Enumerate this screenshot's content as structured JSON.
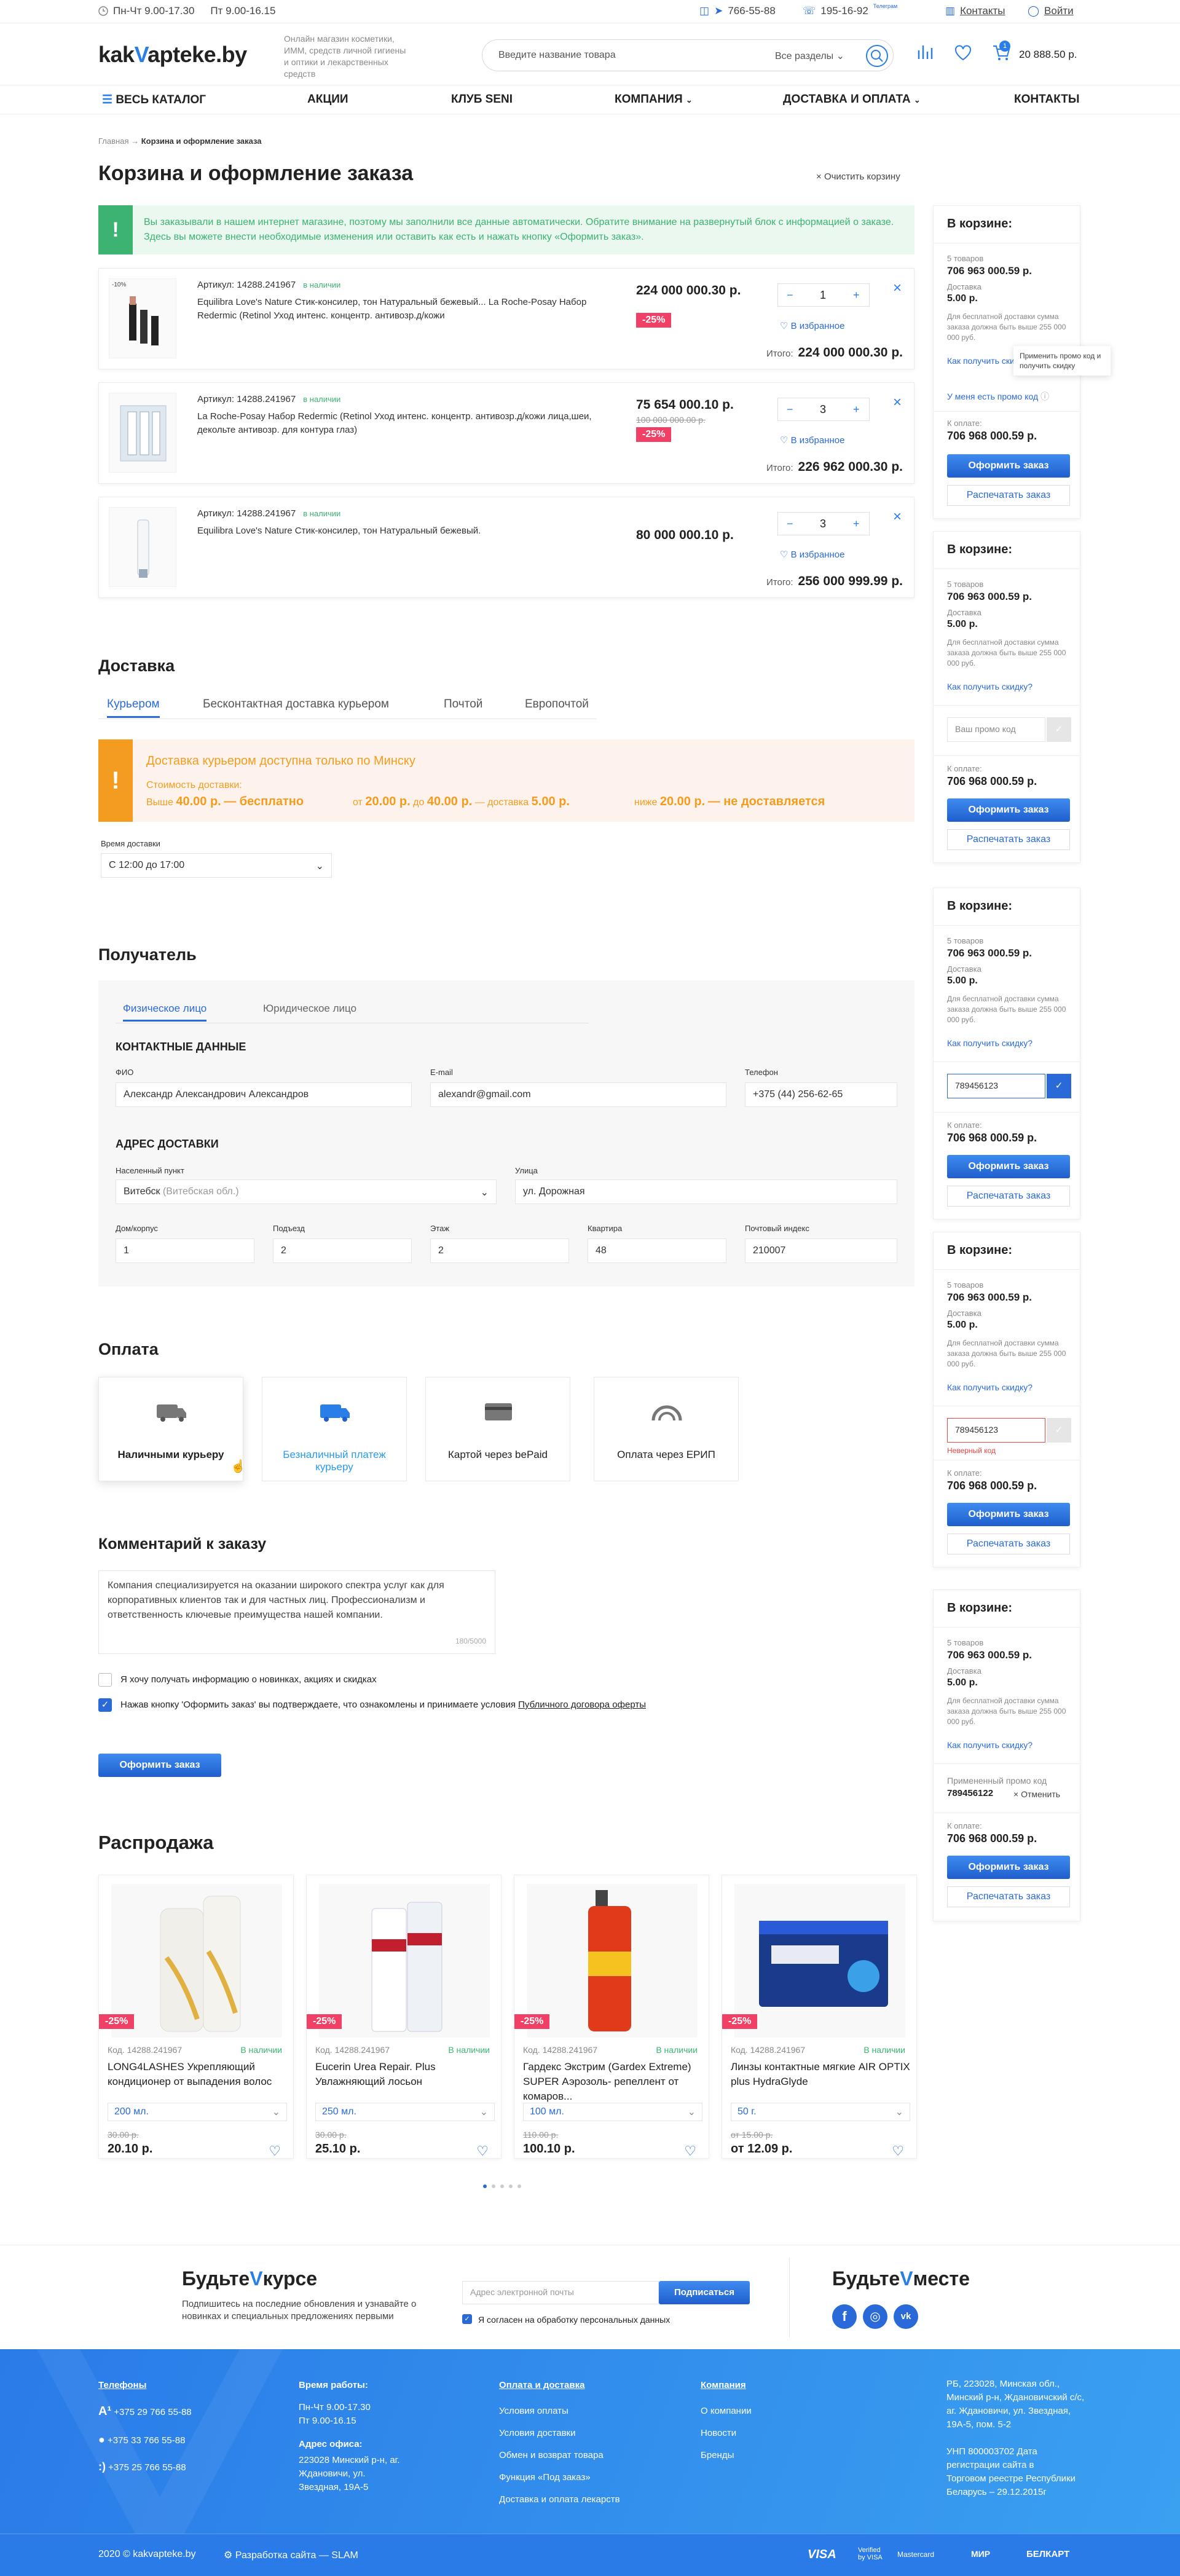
{
  "topbar": {
    "hours1": "Пн-Чт 9.00-17.30",
    "hours2": "Пт 9.00-16.15",
    "phone1": "766-55-88",
    "phone2": "195-16-92",
    "phone2_note": "Телеграм",
    "contacts": "Контакты",
    "login": "Войти"
  },
  "header": {
    "logo_a": "kak",
    "logo_v": "V",
    "logo_b": "apteke.by",
    "tagline": "Онлайн магазин косметики, ИММ, средств личной гигиены и оптики и лекарственных средств",
    "search_placeholder": "Введите название товара",
    "search_section": "Все разделы",
    "cart_count": "1",
    "cart_total": "20 888.50 р."
  },
  "nav": [
    "ВЕСЬ КАТАЛОГ",
    "АКЦИИ",
    "КЛУБ SENI",
    "КОМПАНИЯ",
    "ДОСТАВКА И ОПЛАТА",
    "КОНТАКТЫ"
  ],
  "breadcrumb": {
    "home": "Главная",
    "current": "Корзина и оформление заказа"
  },
  "page_title": "Корзина и оформление заказа",
  "clear_cart": "Очистить корзину",
  "notice": "Вы заказывали в нашем интернет магазине, поэтому мы заполнили все данные автоматически. Обратите внимание на развернутый блок с информацией о заказе. Здесь вы можете внести необходимые изменения или оставить как есть и нажать кнопку «Оформить заказ».",
  "products": [
    {
      "article": "Артикул: 14288.241967",
      "stock": "в наличии",
      "name": "Equilibra Love's Nature Стик-консилер, тон Натуральный бежевый... La Roche-Posay Набор Redermic (Retinol Уход интенс. концентр. антивозр.д/кожи",
      "price": "224 000 000.30 р.",
      "old": "",
      "discount": "-25%",
      "qty": "1",
      "fav": "В избранное",
      "total_label": "Итого:",
      "total": "224 000 000.30 р.",
      "img_badge": "-10%"
    },
    {
      "article": "Артикул: 14288.241967",
      "stock": "в наличии",
      "name": "La Roche-Posay Набор Redermic (Retinol Уход интенс. концентр. антивозр.д/кожи лица,шеи, декольте антивозр. для контура глаз)",
      "price": "75 654 000.10 р.",
      "old": "100 000 000.00 р.",
      "discount": "-25%",
      "qty": "3",
      "fav": "В избранное",
      "total_label": "Итого:",
      "total": "226 962 000.30 р."
    },
    {
      "article": "Артикул: 14288.241967",
      "stock": "в наличии",
      "name": "Equilibra Love's Nature Стик-консилер, тон Натуральный бежевый.",
      "price": "80 000 000.10 р.",
      "old": "",
      "discount": "",
      "qty": "3",
      "fav": "В избранное",
      "total_label": "Итого:",
      "total": "256 000 999.99 р."
    }
  ],
  "delivery": {
    "title": "Доставка",
    "tabs": [
      "Курьером",
      "Бесконтактная доставка курьером",
      "Почтой",
      "Европочтой"
    ],
    "warn_title": "Доставка курьером доступна только по Минску",
    "cost_label": "Стоимость доставки:",
    "c1a": "Выше",
    "c1b": "40.00 р.",
    "c1c": "— бесплатно",
    "c2a": "от",
    "c2b": "20.00 р.",
    "c2c": "до",
    "c2d": "40.00 р.",
    "c2e": "— доставка",
    "c2f": "5.00 р.",
    "c3a": "ниже",
    "c3b": "20.00 р.",
    "c3c": "— не доставляется",
    "time_label": "Время доставки",
    "time_value": "С 12:00 до 17:00"
  },
  "recipient": {
    "title": "Получатель",
    "tabs": [
      "Физическое лицо",
      "Юридическое лицо"
    ],
    "contacts_h": "КОНТАКТНЫЕ ДАННЫЕ",
    "fio_l": "ФИО",
    "fio": "Александр Александрович Александров",
    "email_l": "E-mail",
    "email": "alexandr@gmail.com",
    "phone_l": "Телефон",
    "phone": "+375 (44) 256-62-65",
    "addr_h": "АДРЕС ДОСТАВКИ",
    "city_l": "Населенный пункт",
    "city": "Витебск",
    "city_region": "(Витебская обл.)",
    "street_l": "Улица",
    "street": "ул. Дорожная",
    "house_l": "Дом/корпус",
    "house": "1",
    "porch_l": "Подъезд",
    "porch": "2",
    "floor_l": "Этаж",
    "floor": "2",
    "flat_l": "Квартира",
    "flat": "48",
    "zip_l": "Почтовый индекс",
    "zip": "210007"
  },
  "payment": {
    "title": "Оплата",
    "options": [
      "Наличными курьеру",
      "Безналичный платеж курьеру",
      "Картой через bePaid",
      "Оплата через ЕРИП"
    ]
  },
  "comment": {
    "title": "Комментарий к заказу",
    "text": "Компания специализируется на оказании широкого спектра услуг как для корпоративных клиентов так и для частных лиц. Профессионализм и ответственность ключевые преимущества нашей компании.",
    "counter": "180/5000"
  },
  "agree": {
    "news": "Я хочу получать информацию о новинках, акциях и скидках",
    "offer_a": "Нажав кнопку 'Оформить заказ' вы подтверждаете, что ознакомлены и принимаете условия",
    "offer_link": "Публичного договора оферты"
  },
  "submit": "Оформить заказ",
  "side": {
    "title": "В корзине:",
    "items": "5 товаров",
    "items_sum": "706 963 000.59 р.",
    "delivery_l": "Доставка",
    "delivery_v": "5.00 р.",
    "note": "Для бесплатной доставки сумма заказа должна быть выше 255 000 000 руб.",
    "discount_link": "Как получить скидку?",
    "tooltip": "Применить промо код и получить скидку",
    "promo_link": "У меня есть промо код",
    "promo_ph": "Ваш промо код",
    "promo_val": "789456123",
    "promo_err": "Неверный код",
    "applied_l": "Примененный промо код",
    "applied_v": "789456122",
    "cancel": "Отменить",
    "pay_l": "К оплате:",
    "pay_v": "706 968 000.59 р.",
    "btn": "Оформить заказ",
    "print": "Распечатать заказ"
  },
  "sale": {
    "title": "Распродажа",
    "items": [
      {
        "code": "Код. 14288.241967",
        "stock": "В наличии",
        "name": "LONG4LASHES Укрепляющий кондиционер от выпадения волос",
        "opt": "200 мл.",
        "old": "30.00 р.",
        "price": "20.10 р.",
        "badge": "-25%"
      },
      {
        "code": "Код. 14288.241967",
        "stock": "В наличии",
        "name": "Eucerin Urea Repair. Plus Увлажняющий лосьон",
        "opt": "250 мл.",
        "old": "30.00 р.",
        "price": "25.10 р.",
        "badge": "-25%"
      },
      {
        "code": "Код. 14288.241967",
        "stock": "В наличии",
        "name": "Гардекс Экстрим (Gardex Extreme) SUPER Аэрозоль- репеллент от комаров...",
        "opt": "100 мл.",
        "old": "110.00 р.",
        "price": "100.10 р.",
        "badge": "-25%"
      },
      {
        "code": "Код. 14288.241967",
        "stock": "В наличии",
        "name": "Линзы контактные мягкие AIR OPTIX plus HydraGlyde",
        "opt": "50 г.",
        "old": "от 15.00 р.",
        "price": "от 12.09 р.",
        "badge": "-25%"
      }
    ]
  },
  "subscribe": {
    "title_a": "Будьте",
    "title_v": "V",
    "title_b": "курсе",
    "text": "Подпишитесь на последние обновления и узнавайте о новинках и специальных предложениях первыми",
    "ph": "Адрес электронной почты",
    "btn": "Подписаться",
    "consent": "Я согласен на обработку персональных данных",
    "together_a": "Будьте",
    "together_b": "месте"
  },
  "footer": {
    "phones_h": "Телефоны",
    "phones": [
      "+375 29 766 55-88",
      "+375 33 766 55-88",
      "+375 25 766 55-88"
    ],
    "hours_h": "Время работы:",
    "hours": [
      "Пн-Чт 9.00-17.30",
      "Пт 9.00-16.15"
    ],
    "office_h": "Адрес офиса:",
    "office": "223028 Минский р-н, аг. Ждановичи, ул. Звездная, 19А-5",
    "pay_h": "Оплата и доставка",
    "pay_links": [
      "Условия оплаты",
      "Условия доставки",
      "Обмен и возврат товара",
      "Функция «Под заказ»",
      "Доставка и оплата лекарств"
    ],
    "company_h": "Компания",
    "company_links": [
      "О компании",
      "Новости",
      "Бренды"
    ],
    "legal": "РБ, 223028, Минская обл., Минский р-н, Ждановичский с/с, аг. Ждановичи, ул. Звездная, 19А-5, пом. 5-2",
    "unp": "УНП 800003702 Дата регистрации сайта в Торговом реестре Республики Беларусь – 29.12.2015г",
    "copy": "2020 © kakvapteke.by",
    "dev": "Разработка сайта — SLAM",
    "payments": [
      "VISA",
      "Verified by VISA",
      "Mastercard",
      "МИР",
      "БЕЛКАРТ"
    ]
  },
  "colors": {
    "accent": "#2a6ad8",
    "success": "#3cb371",
    "warning": "#f39c1f",
    "sale": "#f04065"
  }
}
